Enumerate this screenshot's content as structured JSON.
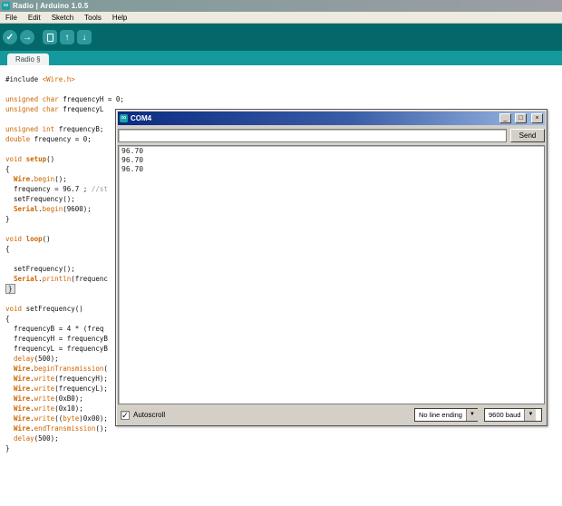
{
  "window": {
    "title": "Radio | Arduino 1.0.5",
    "app_icon": "infinity"
  },
  "menu": {
    "items": [
      "File",
      "Edit",
      "Sketch",
      "Tools",
      "Help"
    ]
  },
  "toolbar": {
    "buttons": [
      {
        "name": "verify",
        "icon": "check-icon",
        "shape": "circle",
        "gap": false
      },
      {
        "name": "upload",
        "icon": "arrow-right-icon",
        "shape": "circle",
        "gap": false
      },
      {
        "name": "new",
        "icon": "document-icon",
        "shape": "square",
        "gap": true
      },
      {
        "name": "open",
        "icon": "arrow-up-icon",
        "shape": "square",
        "gap": false
      },
      {
        "name": "save",
        "icon": "arrow-down-icon",
        "shape": "square",
        "gap": false
      }
    ]
  },
  "tab": {
    "label": "Radio §"
  },
  "editor": {
    "lines": [
      [
        {
          "t": "#include ",
          "c": "p"
        },
        {
          "t": "<Wire.h>",
          "c": "k"
        }
      ],
      [],
      [
        {
          "t": "unsigned char ",
          "c": "k"
        },
        {
          "t": "frequencyH = 0;",
          "c": "p"
        }
      ],
      [
        {
          "t": "unsigned char ",
          "c": "k"
        },
        {
          "t": "frequencyL",
          "c": "p"
        }
      ],
      [],
      [
        {
          "t": "unsigned int ",
          "c": "k"
        },
        {
          "t": "frequencyB;",
          "c": "p"
        }
      ],
      [
        {
          "t": "double ",
          "c": "k"
        },
        {
          "t": "frequency = 0;",
          "c": "p"
        }
      ],
      [],
      [
        {
          "t": "void ",
          "c": "k"
        },
        {
          "t": "setup",
          "c": "b"
        },
        {
          "t": "()",
          "c": "p"
        }
      ],
      [
        {
          "t": "{",
          "c": "p"
        }
      ],
      [
        {
          "t": "  ",
          "c": "p"
        },
        {
          "t": "Wire",
          "c": "b"
        },
        {
          "t": ".",
          "c": "p"
        },
        {
          "t": "begin",
          "c": "k"
        },
        {
          "t": "();",
          "c": "p"
        }
      ],
      [
        {
          "t": "  frequency = 96.7 ; ",
          "c": "p"
        },
        {
          "t": "//st",
          "c": "c"
        }
      ],
      [
        {
          "t": "  setFrequency();",
          "c": "p"
        }
      ],
      [
        {
          "t": "  ",
          "c": "p"
        },
        {
          "t": "Serial",
          "c": "b"
        },
        {
          "t": ".",
          "c": "p"
        },
        {
          "t": "begin",
          "c": "k"
        },
        {
          "t": "(9600);",
          "c": "p"
        }
      ],
      [
        {
          "t": "}",
          "c": "p"
        }
      ],
      [],
      [
        {
          "t": "void ",
          "c": "k"
        },
        {
          "t": "loop",
          "c": "b"
        },
        {
          "t": "()",
          "c": "p"
        }
      ],
      [
        {
          "t": "{",
          "c": "p"
        }
      ],
      [],
      [
        {
          "t": "  setFrequency();",
          "c": "p"
        }
      ],
      [
        {
          "t": "  ",
          "c": "p"
        },
        {
          "t": "Serial",
          "c": "b"
        },
        {
          "t": ".",
          "c": "p"
        },
        {
          "t": "println",
          "c": "k"
        },
        {
          "t": "(frequenc",
          "c": "p"
        }
      ],
      [
        {
          "t": "}",
          "c": "cur"
        }
      ],
      [],
      [
        {
          "t": "void ",
          "c": "k"
        },
        {
          "t": "setFrequency()",
          "c": "p"
        }
      ],
      [
        {
          "t": "{",
          "c": "p"
        }
      ],
      [
        {
          "t": "  frequencyB = 4 * (freq",
          "c": "p"
        }
      ],
      [
        {
          "t": "  frequencyH = frequencyB",
          "c": "p"
        }
      ],
      [
        {
          "t": "  frequencyL = frequencyB",
          "c": "p"
        }
      ],
      [
        {
          "t": "  ",
          "c": "p"
        },
        {
          "t": "delay",
          "c": "k"
        },
        {
          "t": "(500);",
          "c": "p"
        }
      ],
      [
        {
          "t": "  ",
          "c": "p"
        },
        {
          "t": "Wire",
          "c": "b"
        },
        {
          "t": ".",
          "c": "p"
        },
        {
          "t": "beginTransmission",
          "c": "k"
        },
        {
          "t": "(",
          "c": "p"
        }
      ],
      [
        {
          "t": "  ",
          "c": "p"
        },
        {
          "t": "Wire",
          "c": "b"
        },
        {
          "t": ".",
          "c": "p"
        },
        {
          "t": "write",
          "c": "k"
        },
        {
          "t": "(frequencyH);",
          "c": "p"
        }
      ],
      [
        {
          "t": "  ",
          "c": "p"
        },
        {
          "t": "Wire",
          "c": "b"
        },
        {
          "t": ".",
          "c": "p"
        },
        {
          "t": "write",
          "c": "k"
        },
        {
          "t": "(frequencyL);",
          "c": "p"
        }
      ],
      [
        {
          "t": "  ",
          "c": "p"
        },
        {
          "t": "Wire",
          "c": "b"
        },
        {
          "t": ".",
          "c": "p"
        },
        {
          "t": "write",
          "c": "k"
        },
        {
          "t": "(0xB0);",
          "c": "p"
        }
      ],
      [
        {
          "t": "  ",
          "c": "p"
        },
        {
          "t": "Wire",
          "c": "b"
        },
        {
          "t": ".",
          "c": "p"
        },
        {
          "t": "write",
          "c": "k"
        },
        {
          "t": "(0x10);",
          "c": "p"
        }
      ],
      [
        {
          "t": "  ",
          "c": "p"
        },
        {
          "t": "Wire",
          "c": "b"
        },
        {
          "t": ".",
          "c": "p"
        },
        {
          "t": "write",
          "c": "k"
        },
        {
          "t": "((",
          "c": "p"
        },
        {
          "t": "byte",
          "c": "k"
        },
        {
          "t": ")0x00);",
          "c": "p"
        }
      ],
      [
        {
          "t": "  ",
          "c": "p"
        },
        {
          "t": "Wire",
          "c": "b"
        },
        {
          "t": ".",
          "c": "p"
        },
        {
          "t": "endTransmission",
          "c": "k"
        },
        {
          "t": "();",
          "c": "p"
        }
      ],
      [
        {
          "t": "  ",
          "c": "p"
        },
        {
          "t": "delay",
          "c": "k"
        },
        {
          "t": "(500);",
          "c": "p"
        }
      ],
      [
        {
          "t": "}",
          "c": "p"
        }
      ]
    ]
  },
  "serial_monitor": {
    "title": "COM4",
    "app_icon": "infinity",
    "window_buttons": [
      "minimize",
      "maximize",
      "close"
    ],
    "input_value": "",
    "send_label": "Send",
    "output_lines": [
      "96.70",
      "96.70",
      "96.70"
    ],
    "autoscroll_label": "Autoscroll",
    "autoscroll_checked": true,
    "line_ending_value": "No line ending",
    "baud_value": "9600 baud"
  },
  "colors": {
    "toolbar_teal": "#04686B",
    "tabstrip_teal": "#14999C",
    "button_teal": "#2E999C",
    "keyword_orange": "#CC6600",
    "comment_gray": "#9A9A9A",
    "serial_titlebar_left": "#0B2B80",
    "serial_titlebar_right": "#9DBBE4",
    "chrome_gray": "#D4D0C8"
  }
}
